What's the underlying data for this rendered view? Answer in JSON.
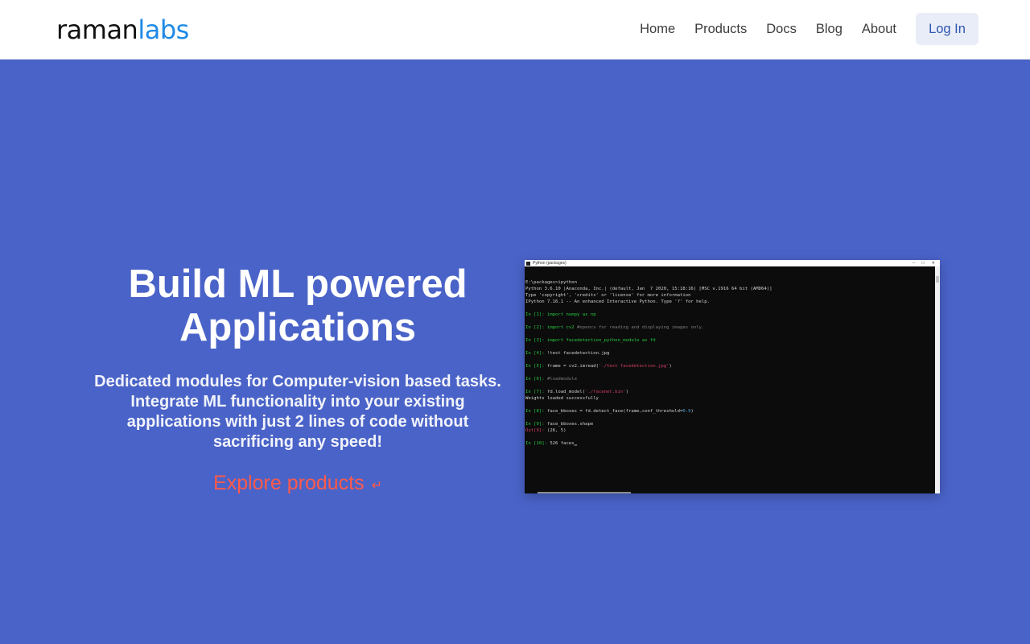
{
  "brand": {
    "part1": "raman",
    "part2": "labs"
  },
  "nav": {
    "links": [
      "Home",
      "Products",
      "Docs",
      "Blog",
      "About"
    ],
    "login": "Log In"
  },
  "hero": {
    "title_line1": "Build ML powered",
    "title_line2": "Applications",
    "subtitle": "Dedicated modules for Computer-vision based tasks. Integrate ML functionality into your existing applications with just 2 lines of code without sacrificing any speed!",
    "cta": "Explore products",
    "cta_icon": "return-arrow-icon"
  },
  "terminal": {
    "window_title": "Python (packages)",
    "lines": {
      "l1": "E:\\packages>ipython",
      "l2": "Python 3.6.10 |Anaconda, Inc.| (default, Jan  7 2020, 15:18:16) [MSC v.1916 64 bit (AMD64)]",
      "l3": "Type 'copyright', 'credits' or 'license' for more information",
      "l4": "IPython 7.16.1 -- An enhanced Interactive Python. Type '?' for help.",
      "p1": "In [1]: ",
      "c1": "import numpy as np",
      "p2": "In [2]: ",
      "c2": "import cv2",
      "c2b": " #opencv for reading and displaying images only.",
      "p3": "In [3]: ",
      "c3": "import facedetection_python_module as fd",
      "p4": "In [4]: ",
      "c4": "!test facedetection.jpg",
      "p5": "In [5]: ",
      "c5": "frame = cv2.imread(",
      "c5s": "'./test facedetection.jpg'",
      "c5e": ")",
      "p6": "In [6]: ",
      "c6": "#loadmodule",
      "p7": "In [7]: ",
      "c7": "fd.load_model(",
      "c7s": "'./facenet.bin'",
      "c7e": ")",
      "o7": "Weights loaded successfully",
      "p8": "In [8]: ",
      "c8": "face_bboxes = fd.detect_face(frame,conf_threshold=",
      "c8n": "0.9",
      "c8e": ")",
      "p9": "In [9]: ",
      "c9": "face_bboxes.shape",
      "o9p": "Out[9]: ",
      "o9": "(26, 5)",
      "p10": "In [10]: ",
      "c10": "526 faces"
    }
  },
  "colors": {
    "hero_bg": "#4a63c8",
    "accent": "#1f8ae6",
    "cta": "#ff5a4a",
    "login_bg": "#e9edf7"
  }
}
